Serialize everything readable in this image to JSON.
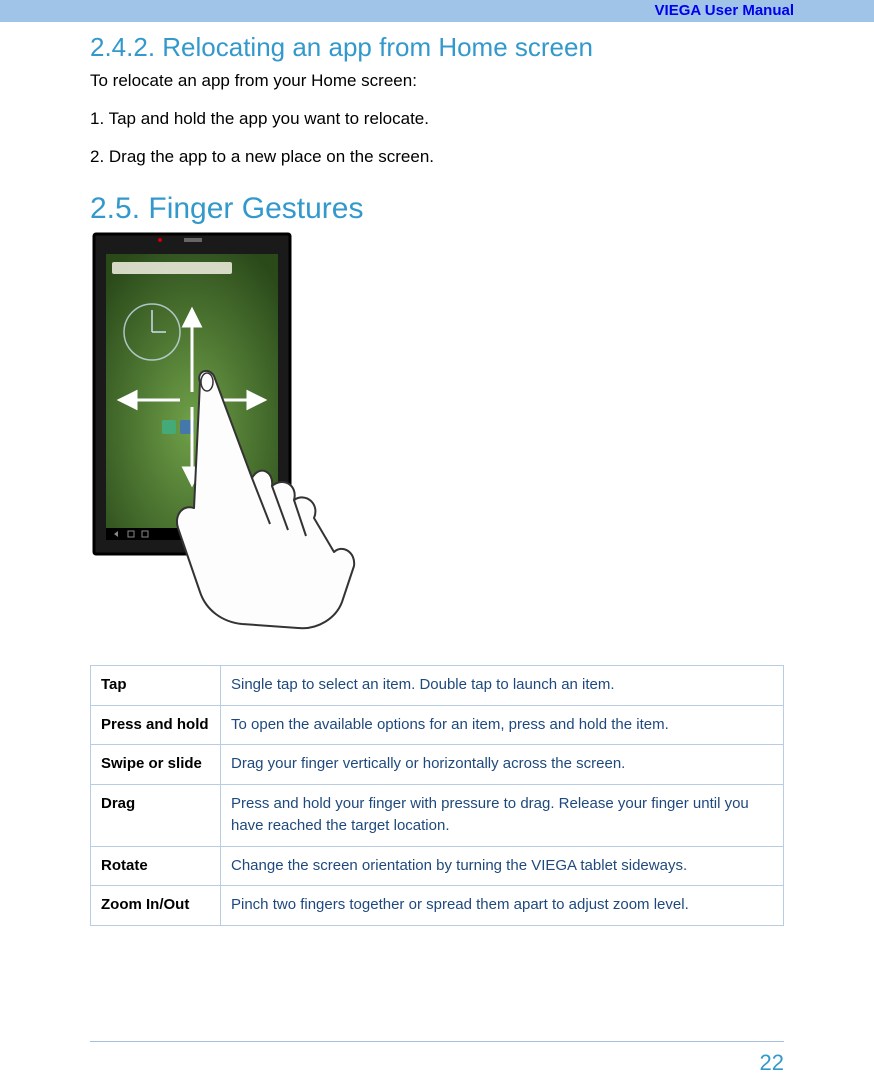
{
  "header": {
    "title": "VIEGA User Manual"
  },
  "section_242": {
    "heading": "2.4.2. Relocating an app from Home screen",
    "intro": "To relocate an app from your Home screen:",
    "steps": [
      "1. Tap and hold the app you want to relocate.",
      "2. Drag the app to a new place on the screen."
    ]
  },
  "section_25": {
    "heading": "2.5. Finger Gestures"
  },
  "gesture_table": [
    {
      "term": "Tap",
      "desc": "Single tap to select an item. Double tap to launch an item."
    },
    {
      "term": "Press and hold",
      "desc": "To open the available options for an item, press and hold the item."
    },
    {
      "term": "Swipe or slide",
      "desc": "Drag your finger vertically or horizontally across the screen."
    },
    {
      "term": "Drag",
      "desc": "Press and hold your finger with pressure to drag. Release your finger until you have reached the target location."
    },
    {
      "term": "Rotate",
      "desc": "Change the screen orientation by turning the VIEGA tablet sideways."
    },
    {
      "term": "Zoom In/Out",
      "desc": "Pinch two fingers together or spread them apart to adjust zoom level."
    }
  ],
  "page_number": "22"
}
